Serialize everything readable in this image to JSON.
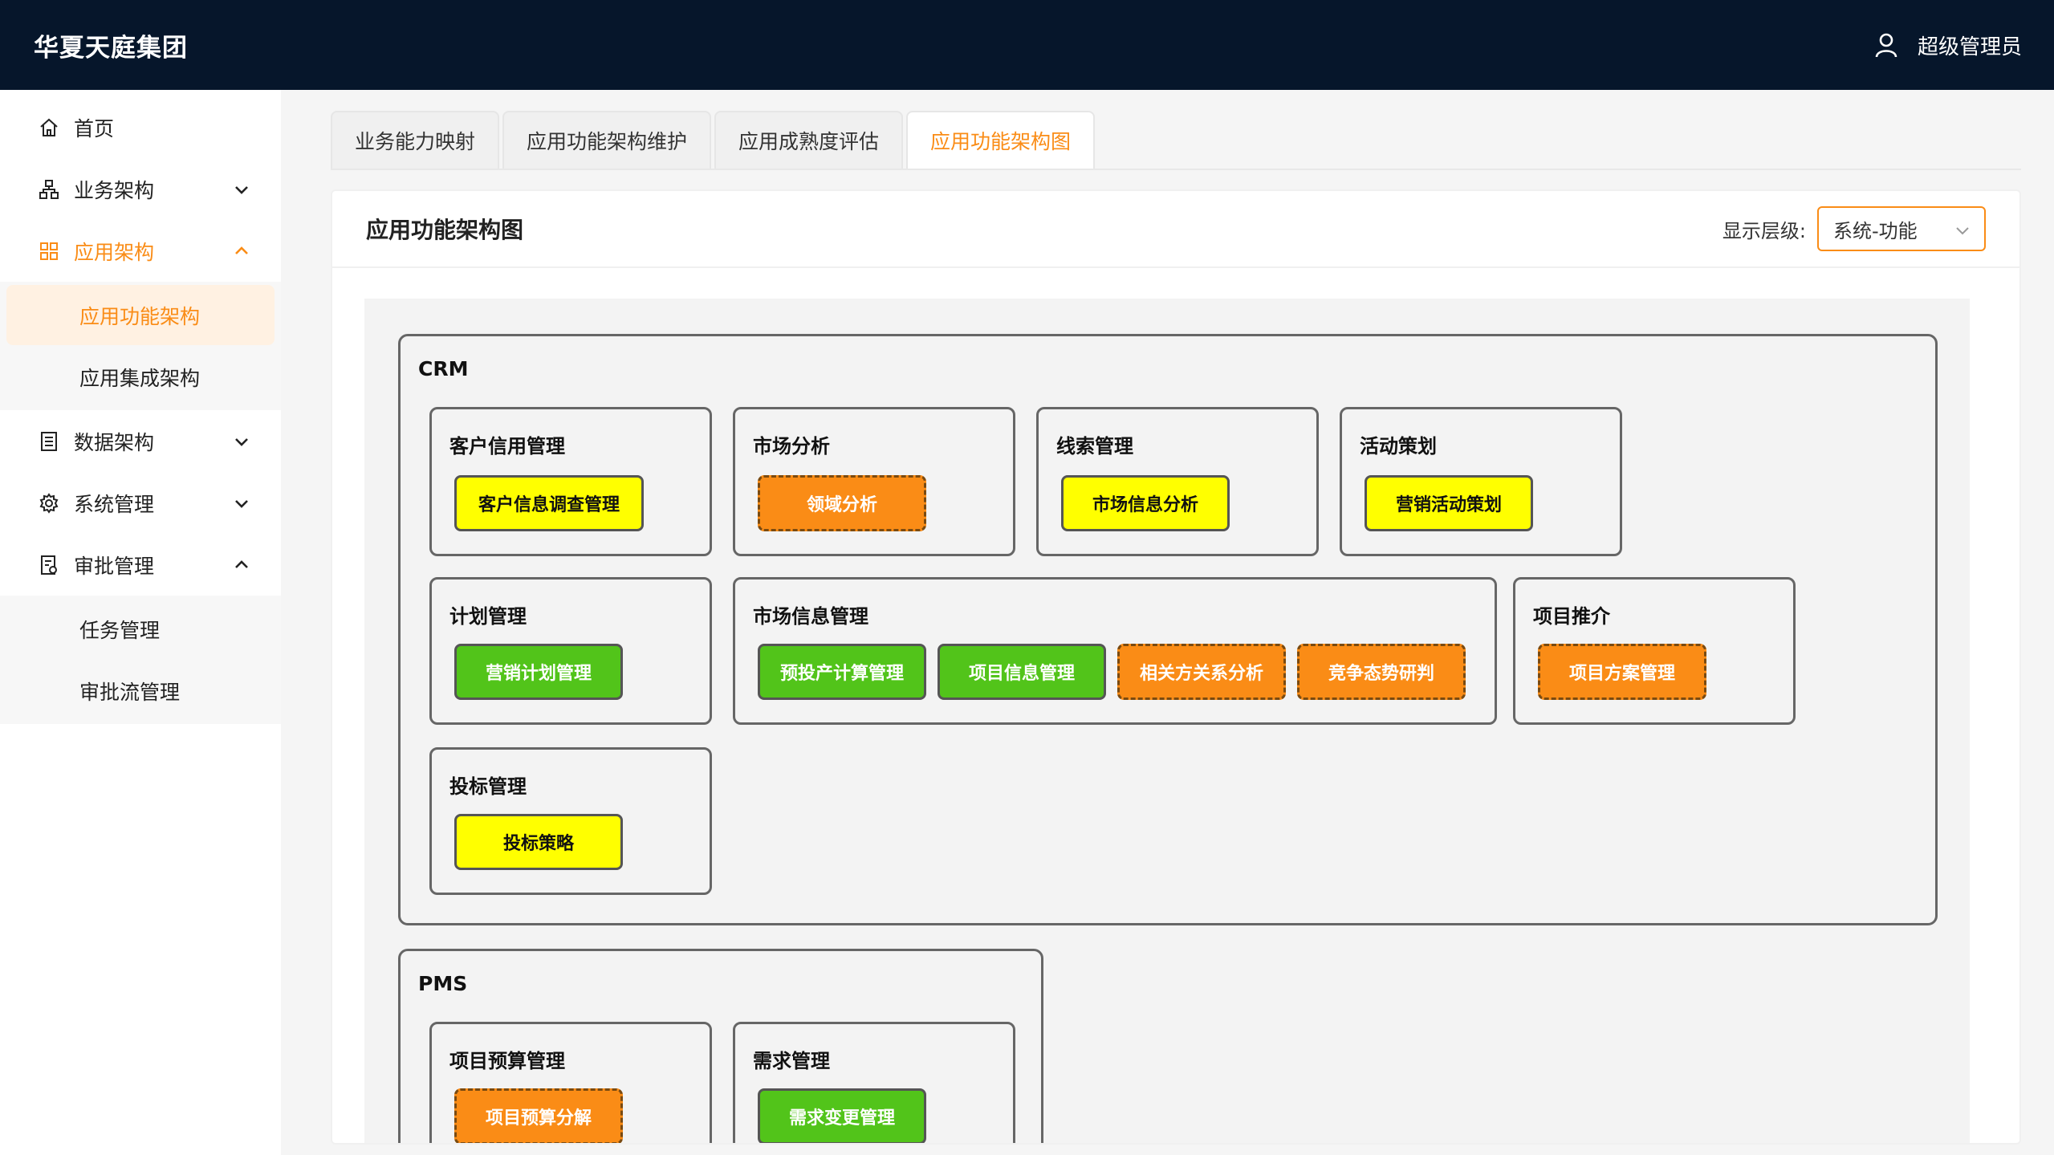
{
  "header": {
    "brand": "华夏天庭集团",
    "user": "超级管理员",
    "user_icon": "user-icon"
  },
  "sidebar": {
    "home": "首页",
    "business_arch": "业务架构",
    "app_arch": "应用架构",
    "app_function_arch": "应用功能架构",
    "app_integration_arch": "应用集成架构",
    "data_arch": "数据架构",
    "system_mgmt": "系统管理",
    "approval_mgmt": "审批管理",
    "task_mgmt": "任务管理",
    "approval_flow_mgmt": "审批流管理"
  },
  "tabs": [
    "业务能力映射",
    "应用功能架构维护",
    "应用成熟度评估",
    "应用功能架构图"
  ],
  "active_tab": 3,
  "panel": {
    "title": "应用功能架构图",
    "level_label": "显示层级:",
    "level_value": "系统-功能"
  },
  "colors": {
    "accent": "#fa8c16",
    "yellow": "#ffff00",
    "green": "#52c41a",
    "header_bg": "#06162b"
  },
  "diagram": {
    "crm": {
      "name": "CRM",
      "groups": [
        {
          "name": "客户信用管理",
          "functions": [
            "客户信息调查管理"
          ]
        },
        {
          "name": "市场分析",
          "functions": [
            "领域分析"
          ]
        },
        {
          "name": "线索管理",
          "functions": [
            "市场信息分析"
          ]
        },
        {
          "name": "活动策划",
          "functions": [
            "营销活动策划"
          ]
        },
        {
          "name": "计划管理",
          "functions": [
            "营销计划管理"
          ]
        },
        {
          "name": "市场信息管理",
          "functions": [
            "预投产计算管理",
            "项目信息管理",
            "相关方关系分析",
            "竞争态势研判"
          ]
        },
        {
          "name": "项目推介",
          "functions": [
            "项目方案管理"
          ]
        },
        {
          "name": "投标管理",
          "functions": [
            "投标策略"
          ]
        }
      ]
    },
    "pms": {
      "name": "PMS",
      "groups": [
        {
          "name": "项目预算管理",
          "functions": [
            "项目预算分解"
          ]
        },
        {
          "name": "需求管理",
          "functions": [
            "需求变更管理"
          ]
        }
      ]
    }
  }
}
